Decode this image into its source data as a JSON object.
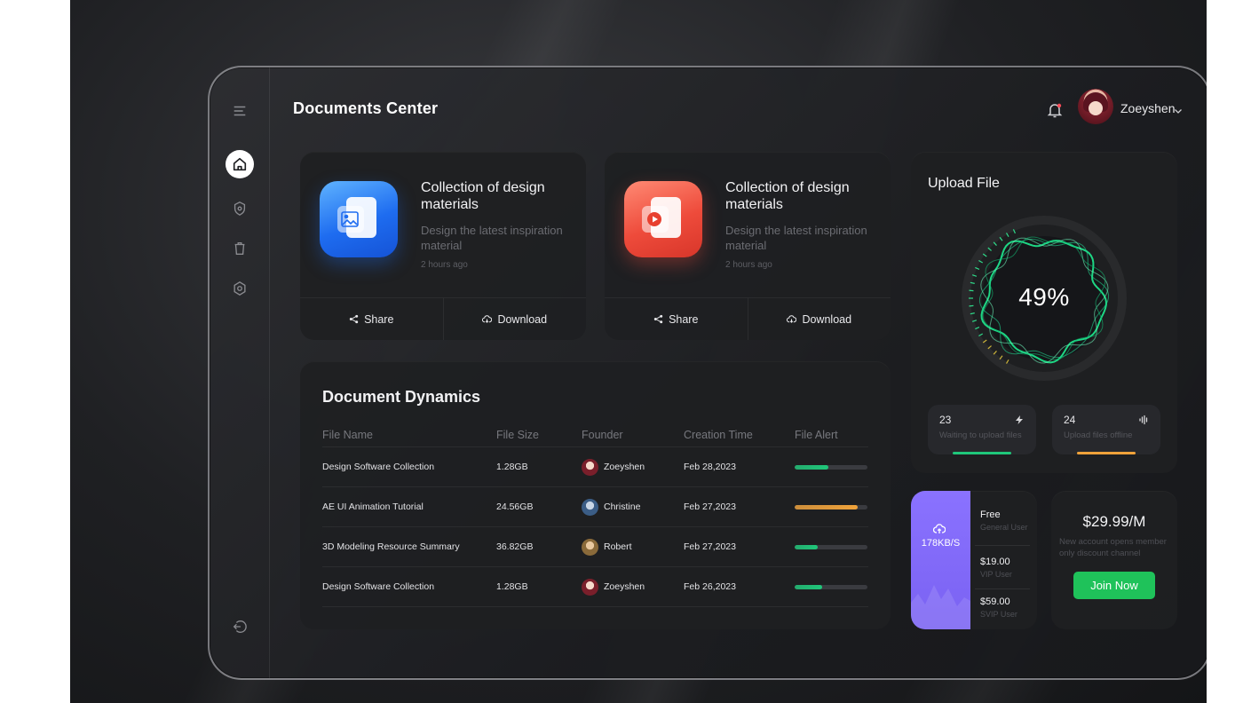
{
  "app": {
    "title": "Documents Center"
  },
  "user": {
    "name": "Zoeyshen",
    "avatar": "avatar-icon"
  },
  "sidebar": {
    "items": [
      {
        "name": "menu",
        "icon": "menu-icon"
      },
      {
        "name": "home",
        "icon": "home-icon",
        "active": true
      },
      {
        "name": "shield",
        "icon": "shield-icon"
      },
      {
        "name": "trash",
        "icon": "trash-icon"
      },
      {
        "name": "settings",
        "icon": "gear-icon"
      },
      {
        "name": "logout",
        "icon": "logout-icon"
      }
    ]
  },
  "doc_cards": [
    {
      "title": "Collection of design materials",
      "desc": "Design the latest inspiration material",
      "time": "2 hours ago",
      "share_label": "Share",
      "download_label": "Download",
      "icon": "image-file-icon",
      "color": "#1e6cf0"
    },
    {
      "title": "Collection of design materials",
      "desc": "Design the latest inspiration material",
      "time": "2 hours ago",
      "share_label": "Share",
      "download_label": "Download",
      "icon": "video-file-icon",
      "color": "#ee4b3b"
    }
  ],
  "dynamics": {
    "title": "Document Dynamics",
    "columns": [
      "File Name",
      "File Size",
      "Founder",
      "Creation Time",
      "File Alert"
    ],
    "rows": [
      {
        "file": "Design Software Collection",
        "size": "1.28GB",
        "founder": "Zoeyshen",
        "date": "Feb 28,2023",
        "alert": 0.46,
        "alert_color": "#1fc77a"
      },
      {
        "file": "AE UI Animation Tutorial",
        "size": "24.56GB",
        "founder": "Christine",
        "date": "Feb 27,2023",
        "alert": 0.86,
        "alert_color": "#f0a23a"
      },
      {
        "file": "3D Modeling Resource Summary",
        "size": "36.82GB",
        "founder": "Robert",
        "date": "Feb 27,2023",
        "alert": 0.32,
        "alert_color": "#1fc77a"
      },
      {
        "file": "Design Software Collection",
        "size": "1.28GB",
        "founder": "Zoeyshen",
        "date": "Feb 26,2023",
        "alert": 0.38,
        "alert_color": "#1fc77a"
      }
    ]
  },
  "upload": {
    "title": "Upload File",
    "percent_label": "49%",
    "percent": 0.49,
    "stats": [
      {
        "value": "23",
        "label": "Waiting to upload files",
        "icon": "flash-icon",
        "color": "#1fc77a"
      },
      {
        "value": "24",
        "label": "Upload files offline",
        "icon": "waveform-icon",
        "color": "#f0a23a"
      }
    ]
  },
  "plans": {
    "speed": "178KB/S",
    "items": [
      {
        "name": "Free",
        "sub": "General User"
      },
      {
        "name": "$19.00",
        "sub": "VIP User"
      },
      {
        "name": "$59.00",
        "sub": "SVIP User"
      }
    ]
  },
  "promo": {
    "price": "$29.99/M",
    "desc": "New account opens member only discount channel",
    "button": "Join Now"
  },
  "colors": {
    "accent_green": "#1fc25a",
    "purple": "#7a62f2"
  }
}
